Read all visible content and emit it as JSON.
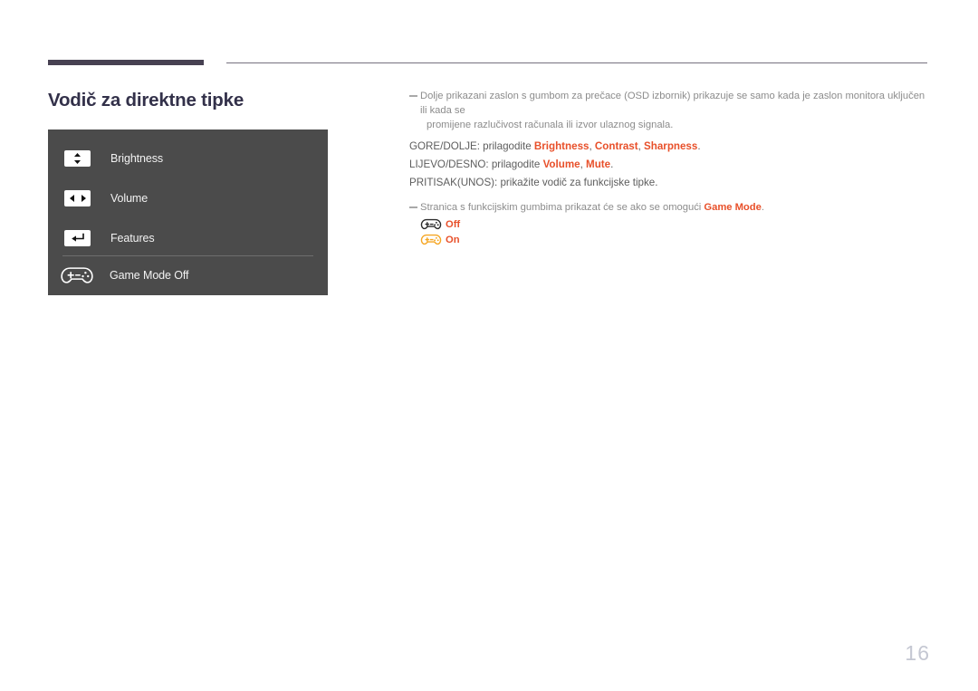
{
  "document": {
    "page_number": "16",
    "title": "Vodič za direktne tipke"
  },
  "osd_panel": {
    "rows": [
      {
        "icon": "up-down-arrows-key-icon",
        "label": "Brightness"
      },
      {
        "icon": "left-right-arrows-key-icon",
        "label": "Volume"
      },
      {
        "icon": "enter-key-icon",
        "label": "Features"
      },
      {
        "icon": "gamepad-icon",
        "label": "Game Mode Off"
      }
    ]
  },
  "notes": {
    "note1": "Dolje prikazani zaslon s gumbom za prečace (OSD izbornik) prikazuje se samo kada je zaslon monitora uključen ili kada se",
    "note1_cont": "promijene razlučivost računala ili izvor ulaznog signala.",
    "note2_before": "Stranica s funkcijskim gumbima prikazat će se ako se omogući ",
    "note2_bold": "Game Mode",
    "note2_after": "."
  },
  "instructions": {
    "line1": {
      "prefix": "GORE/DOLJE: prilagodite ",
      "terms": [
        "Brightness",
        "Contrast",
        "Sharpness"
      ],
      "sep": ", ",
      "suffix": "."
    },
    "line2": {
      "prefix": "LIJEVO/DESNO: prilagodite ",
      "terms": [
        "Volume",
        "Mute"
      ],
      "sep": ", ",
      "suffix": "."
    },
    "line3": {
      "text": "PRITISAK(UNOS): prikažite vodič za funkcijske tipke."
    }
  },
  "game_mode_legend": [
    {
      "icon": "gamepad-icon-outline-dark",
      "label": "Off",
      "color": "#2b2b2b"
    },
    {
      "icon": "gamepad-icon-outline-orange",
      "label": "On",
      "color": "#f5a623"
    }
  ],
  "colors": {
    "accent_red": "#e8502a",
    "title_navy": "#33314a",
    "panel_gray": "#4b4b4b",
    "rule_dark": "#474152",
    "page_number_gray": "#c4c7d2",
    "orange": "#f5a623"
  }
}
